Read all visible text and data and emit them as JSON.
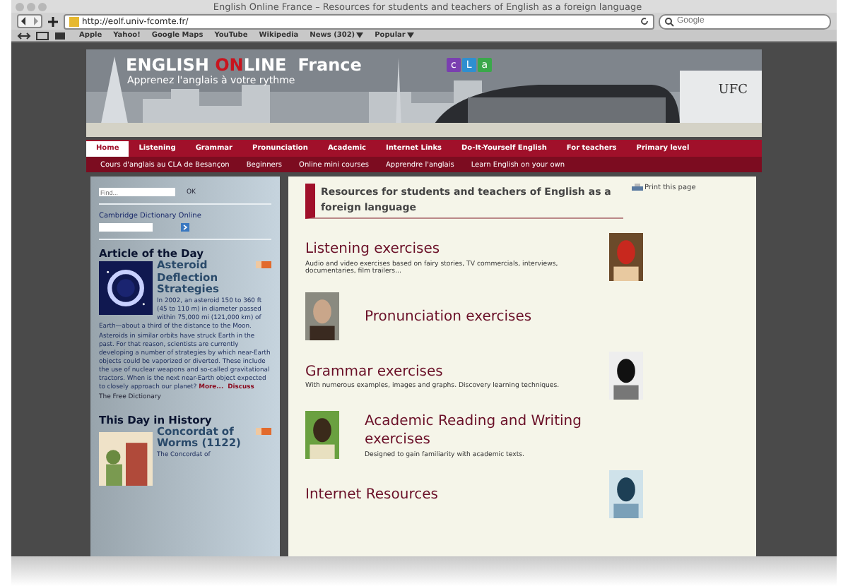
{
  "window": {
    "title": "English Online France – Resources for students and teachers of English as a foreign language"
  },
  "toolbar": {
    "url": "http://eolf.univ-fcomte.fr/",
    "search": {
      "placeholder": "Google"
    }
  },
  "bookmarks": [
    {
      "label": "Apple",
      "menu": false
    },
    {
      "label": "Yahoo!",
      "menu": false
    },
    {
      "label": "Google Maps",
      "menu": false
    },
    {
      "label": "YouTube",
      "menu": false
    },
    {
      "label": "Wikipedia",
      "menu": false
    },
    {
      "label": "News (302)",
      "menu": true
    },
    {
      "label": "Popular",
      "menu": true
    }
  ],
  "banner": {
    "title_parts": [
      {
        "text": "ENGLISH ",
        "highlight": false
      },
      {
        "text": "ON",
        "highlight": true
      },
      {
        "text": "LINE",
        "highlight": false
      }
    ],
    "title_suffix": "France",
    "subtitle": "Apprenez l'anglais à votre rythme",
    "badge_letters": [
      {
        "text": "c",
        "color": "#7a3fb0"
      },
      {
        "text": "L",
        "color": "#2f8fd0"
      },
      {
        "text": "a",
        "color": "#3aa84a"
      }
    ],
    "university": "UFC"
  },
  "nav": {
    "primary": [
      {
        "label": "Home",
        "selected": true
      },
      {
        "label": "Listening",
        "selected": false
      },
      {
        "label": "Grammar",
        "selected": false
      },
      {
        "label": "Pronunciation",
        "selected": false
      },
      {
        "label": "Academic",
        "selected": false
      },
      {
        "label": "Internet Links",
        "selected": false
      },
      {
        "label": "Do-It-Yourself English",
        "selected": false
      },
      {
        "label": "For teachers",
        "selected": false
      },
      {
        "label": "Primary level",
        "selected": false
      }
    ],
    "secondary": [
      "Cours d'anglais au CLA de Besançon",
      "Beginners",
      "Online mini courses",
      "Apprendre l'anglais",
      "Learn English on your own"
    ]
  },
  "sidebar": {
    "find": {
      "placeholder": "Find...",
      "button": "OK"
    },
    "dictionary": {
      "label": "Cambridge Dictionary Online"
    },
    "article": {
      "heading": "Article of the Day",
      "title": "Asteroid Deflection Strategies",
      "text": "In 2002, an asteroid 150 to 360 ft (45 to 110 m) in diameter passed within 75,000 mi (121,000 km) of Earth—about a third of the distance to the Moon. Asteroids in similar orbits have struck Earth in the past. For that reason, scientists are currently developing a number of strategies by which near-Earth objects could be vaporized or diverted. These include the use of nuclear weapons and so-called gravitational tractors. When is the next near-Earth object expected to closely approach our planet?",
      "links": [
        "More...",
        "Discuss"
      ],
      "source": "The Free Dictionary"
    },
    "history": {
      "heading": "This Day in History",
      "title": "Concordat of Worms (1122)",
      "text": "The Concordat of"
    }
  },
  "content": {
    "heading": "Resources for students and teachers of English as a foreign language",
    "print": "Print this page",
    "sections": [
      {
        "title": "Listening exercises",
        "text": "Audio and video exercises based on fairy stories, TV commercials, interviews, documentaries, film trailers...",
        "kind": "right"
      },
      {
        "title": "Pronunciation exercises",
        "kind": "left"
      },
      {
        "title": "Grammar exercises",
        "text": "With numerous examples, images and graphs. Discovery learning techniques.",
        "kind": "right"
      },
      {
        "title": "Academic Reading and Writing exercises",
        "text": "Designed to gain familiarity with academic texts.",
        "kind": "left"
      },
      {
        "title": "Internet Resources",
        "kind": "right"
      }
    ]
  }
}
